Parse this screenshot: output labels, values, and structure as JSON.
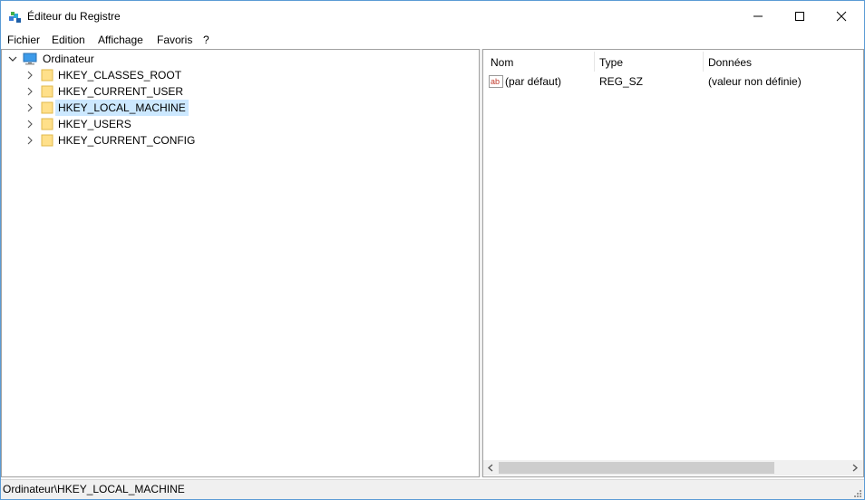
{
  "window": {
    "title": "Éditeur du Registre"
  },
  "menu": [
    "Fichier",
    "Edition",
    "Affichage",
    "Favoris",
    "?"
  ],
  "tree": {
    "root": "Ordinateur",
    "keys": [
      "HKEY_CLASSES_ROOT",
      "HKEY_CURRENT_USER",
      "HKEY_LOCAL_MACHINE",
      "HKEY_USERS",
      "HKEY_CURRENT_CONFIG"
    ],
    "selected": "HKEY_LOCAL_MACHINE"
  },
  "list": {
    "columns": [
      "Nom",
      "Type",
      "Données"
    ],
    "rows": [
      {
        "name": "(par défaut)",
        "type": "REG_SZ",
        "data": "(valeur non définie)",
        "icon": "string-value-icon"
      }
    ]
  },
  "status": {
    "path": "Ordinateur\\HKEY_LOCAL_MACHINE"
  },
  "colors": {
    "selection": "#cce8ff",
    "folder": "#ffe08a",
    "accent_border": "#5b9bd5"
  }
}
